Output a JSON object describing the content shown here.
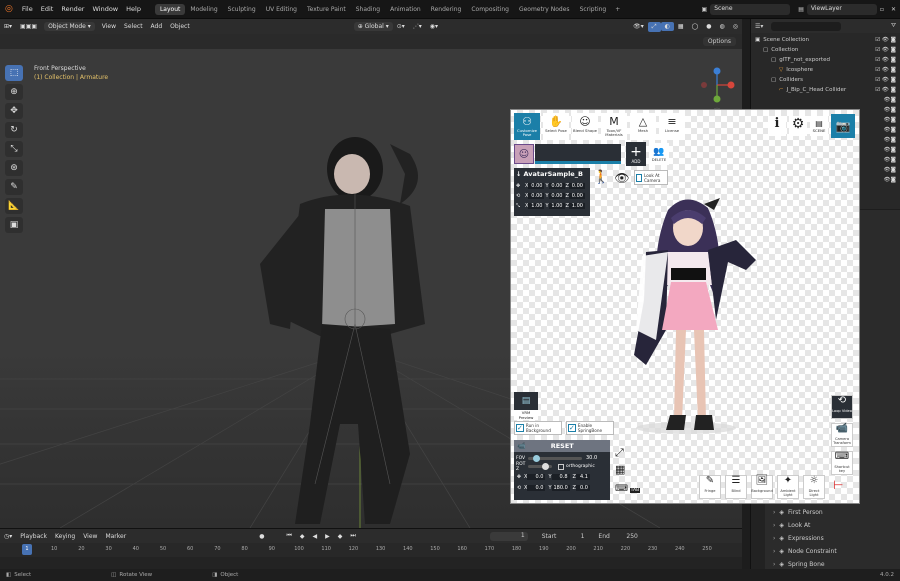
{
  "topbar": {
    "menus": [
      "File",
      "Edit",
      "Render",
      "Window",
      "Help"
    ],
    "workspaces": [
      "Layout",
      "Modeling",
      "Sculpting",
      "UV Editing",
      "Texture Paint",
      "Shading",
      "Animation",
      "Rendering",
      "Compositing",
      "Geometry Nodes",
      "Scripting"
    ],
    "active_workspace": "Layout",
    "scene": "Scene",
    "view_layer": "ViewLayer"
  },
  "viewport": {
    "mode": "Object Mode",
    "menus": [
      "View",
      "Select",
      "Add",
      "Object"
    ],
    "transform": "Global",
    "options_label": "Options",
    "view_name": "Front Perspective",
    "context": "(1) Collection | Armature"
  },
  "outliner": {
    "items": [
      {
        "label": "Scene Collection",
        "depth": 0
      },
      {
        "label": "Collection",
        "depth": 1
      },
      {
        "label": "glTF_not_exported",
        "depth": 2
      },
      {
        "label": "Icosphere",
        "depth": 3
      },
      {
        "label": "Colliders",
        "depth": 2
      },
      {
        "label": "J_Bip_C_Head Collider",
        "depth": 3
      }
    ]
  },
  "properties": {
    "items": [
      "Humanoid",
      "First Person",
      "Look At",
      "Expressions",
      "Node Constraint",
      "Spring Bone"
    ]
  },
  "timeline": {
    "menus": [
      "Playback",
      "Keying",
      "View",
      "Marker"
    ],
    "current_frame": "1",
    "start_label": "Start",
    "start": "1",
    "end_label": "End",
    "end": "250",
    "ticks": [
      "1",
      "10",
      "20",
      "30",
      "40",
      "50",
      "60",
      "70",
      "80",
      "90",
      "100",
      "110",
      "120",
      "130",
      "140",
      "150",
      "160",
      "170",
      "180",
      "190",
      "200",
      "210",
      "220",
      "230",
      "240",
      "250"
    ]
  },
  "status": {
    "items": [
      "Select",
      "Rotate View",
      "Object"
    ],
    "version": "4.0.2"
  },
  "app": {
    "top_tools": [
      {
        "label": "Customize Pose",
        "icon": "pose-icon",
        "selected": true
      },
      {
        "label": "Select Pose",
        "icon": "select-pose-icon",
        "selected": false
      },
      {
        "label": "Blend Shape",
        "icon": "smiley-icon",
        "selected": false
      },
      {
        "label": "Toon/VF Materials",
        "icon": "materials-icon",
        "selected": false
      },
      {
        "label": "Mesh",
        "icon": "mesh-icon",
        "selected": false
      },
      {
        "label": "License",
        "icon": "license-icon",
        "selected": false
      }
    ],
    "right_tools": [
      "info-icon",
      "gear-icon",
      "scene-icon",
      "camera-icon"
    ],
    "scene_label": "SCENE",
    "add_label": "ADD",
    "delete_label": "DELETE",
    "avatar_name": "AvatarSample_B",
    "look_at_camera": "Look At Camera",
    "transform": {
      "pos": {
        "x": "0.00",
        "y": "0.00",
        "z": "0.00"
      },
      "rot": {
        "x": "0.00",
        "y": "0.00",
        "z": "0.00"
      },
      "scale": {
        "x": "1.00",
        "y": "1.00",
        "z": "1.00"
      }
    },
    "vrm_preview": "VRM Preview",
    "run_in_background": "Run in Background",
    "enable_springbone": "Enable SpringBone",
    "reset_label": "RESET",
    "fov_label": "FOV",
    "fov_value": "30.0",
    "rot_z_label": "ROT Z",
    "orthographic": "orthographic",
    "camera_pos": {
      "x": "0.0",
      "y": "0.8",
      "z": "4.1"
    },
    "camera_rot": {
      "x": "0.0",
      "y": "180.0",
      "z": "0.0"
    },
    "tab_label": "TAB",
    "side_tools": [
      "Loop Video",
      "Camera Transform",
      "Shortcut key"
    ],
    "bottom_tools": [
      "Fringe",
      "Blind",
      "Background",
      "Ambient Light",
      "Direct Light"
    ]
  }
}
